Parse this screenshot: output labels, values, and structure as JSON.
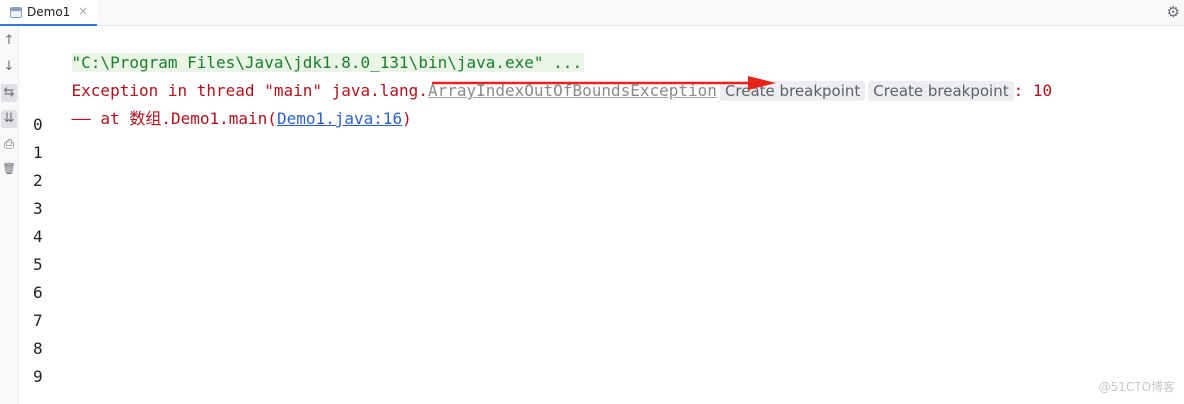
{
  "tab": {
    "label": "Demo1",
    "close": "×",
    "icon": "java-class-file-icon"
  },
  "toolbar": {
    "settings_icon": "⚙"
  },
  "gutter": {
    "up": "↑",
    "down": "↓",
    "wrap": "⇆",
    "scroll": "⇊",
    "print": "⎙",
    "trash": "🗑"
  },
  "console": {
    "command_line": "\"C:\\Program Files\\Java\\jdk1.8.0_131\\bin\\java.exe\" ...",
    "exception": {
      "prefix": "Exception in thread \"main\" java.lang.",
      "class_name": "ArrayIndexOutOfBoundsException",
      "hint1": "Create breakpoint",
      "hint2": "Create breakpoint",
      "suffix": ": 10"
    },
    "stack": {
      "dash": "——",
      "prefix": " at 数组.Demo1.main(",
      "link": "Demo1.java:16",
      "suffix": ")"
    },
    "outputs": [
      "0",
      "1",
      "2",
      "3",
      "4",
      "5",
      "6",
      "7",
      "8",
      "9"
    ]
  },
  "watermark": "@51CTO博客",
  "colors": {
    "accent": "#3574f0",
    "error": "#b3101c",
    "command": "#1a7f2e",
    "link": "#2a64c8",
    "arrow": "#e8231a"
  }
}
